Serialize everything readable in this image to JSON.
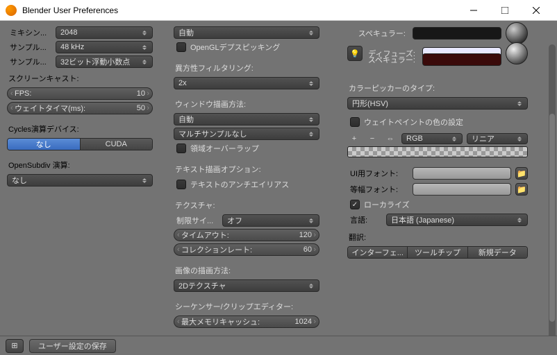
{
  "window": {
    "title": "Blender User Preferences"
  },
  "col1": {
    "mixing_label": "ミキシン...",
    "mixing_value": "2048",
    "sample_label": "サンプル...",
    "sample_value": "48 kHz",
    "sample2_label": "サンプル...",
    "sample2_value": "32ビット浮動小数点",
    "screencast_header": "スクリーンキャスト:",
    "fps_label": "FPS:",
    "fps_value": "10",
    "wait_label": "ウェイトタイマ(ms):",
    "wait_value": "50",
    "cycles_header": "Cycles演算デバイス:",
    "seg_none": "なし",
    "seg_cuda": "CUDA",
    "opensubdiv_header": "OpenSubdiv 演算:",
    "opensubdiv_value": "なし"
  },
  "col2": {
    "auto_value": "自動",
    "opengl_chk": "OpenGLデプスピッキング",
    "aniso_header": "異方性フィルタリング:",
    "aniso_value": "2x",
    "window_header": "ウィンドウ描画方法:",
    "window_value": "自動",
    "multisample_value": "マルチサンプルなし",
    "region_chk": "領域オーバーラップ",
    "text_header": "テキスト描画オプション:",
    "text_chk": "テキストのアンチエイリアス",
    "texture_header": "テクスチャ:",
    "limit_label": "制限サイ...",
    "limit_value": "オフ",
    "timeout_label": "タイムアウト:",
    "timeout_value": "120",
    "collection_label": "コレクションレート:",
    "collection_value": "60",
    "image_header": "画像の描画方法:",
    "image_value": "2Dテクスチャ",
    "sequencer_header": "シーケンサー/クリップエディター:",
    "memcache_label": "最大メモリキャッシュ:",
    "memcache_value": "1024"
  },
  "col3": {
    "specular_label": "スペキュラー:",
    "diffuse_label": "ディフューズ:",
    "specular2_label": "スペキュラー:",
    "colorpicker_header": "カラーピッカーのタイプ:",
    "colorpicker_value": "円形(HSV)",
    "weight_chk": "ウェイトペイントの色の設定",
    "rgb_label": "RGB",
    "linear_label": "リニア",
    "ui_font_label": "UI用フォント:",
    "mono_font_label": "等幅フォント:",
    "localize_chk": "ローカライズ",
    "lang_label": "言語:",
    "lang_value": "日本語 (Japanese)",
    "translate_label": "翻訳:",
    "seg_interface": "インターフェ...",
    "seg_tooltip": "ツールチップ",
    "seg_newdata": "新規データ"
  },
  "bottom": {
    "save_label": "ユーザー設定の保存"
  },
  "colors": {
    "diffuse": "#e8e8ff",
    "spec1": "#3a0a0a"
  }
}
